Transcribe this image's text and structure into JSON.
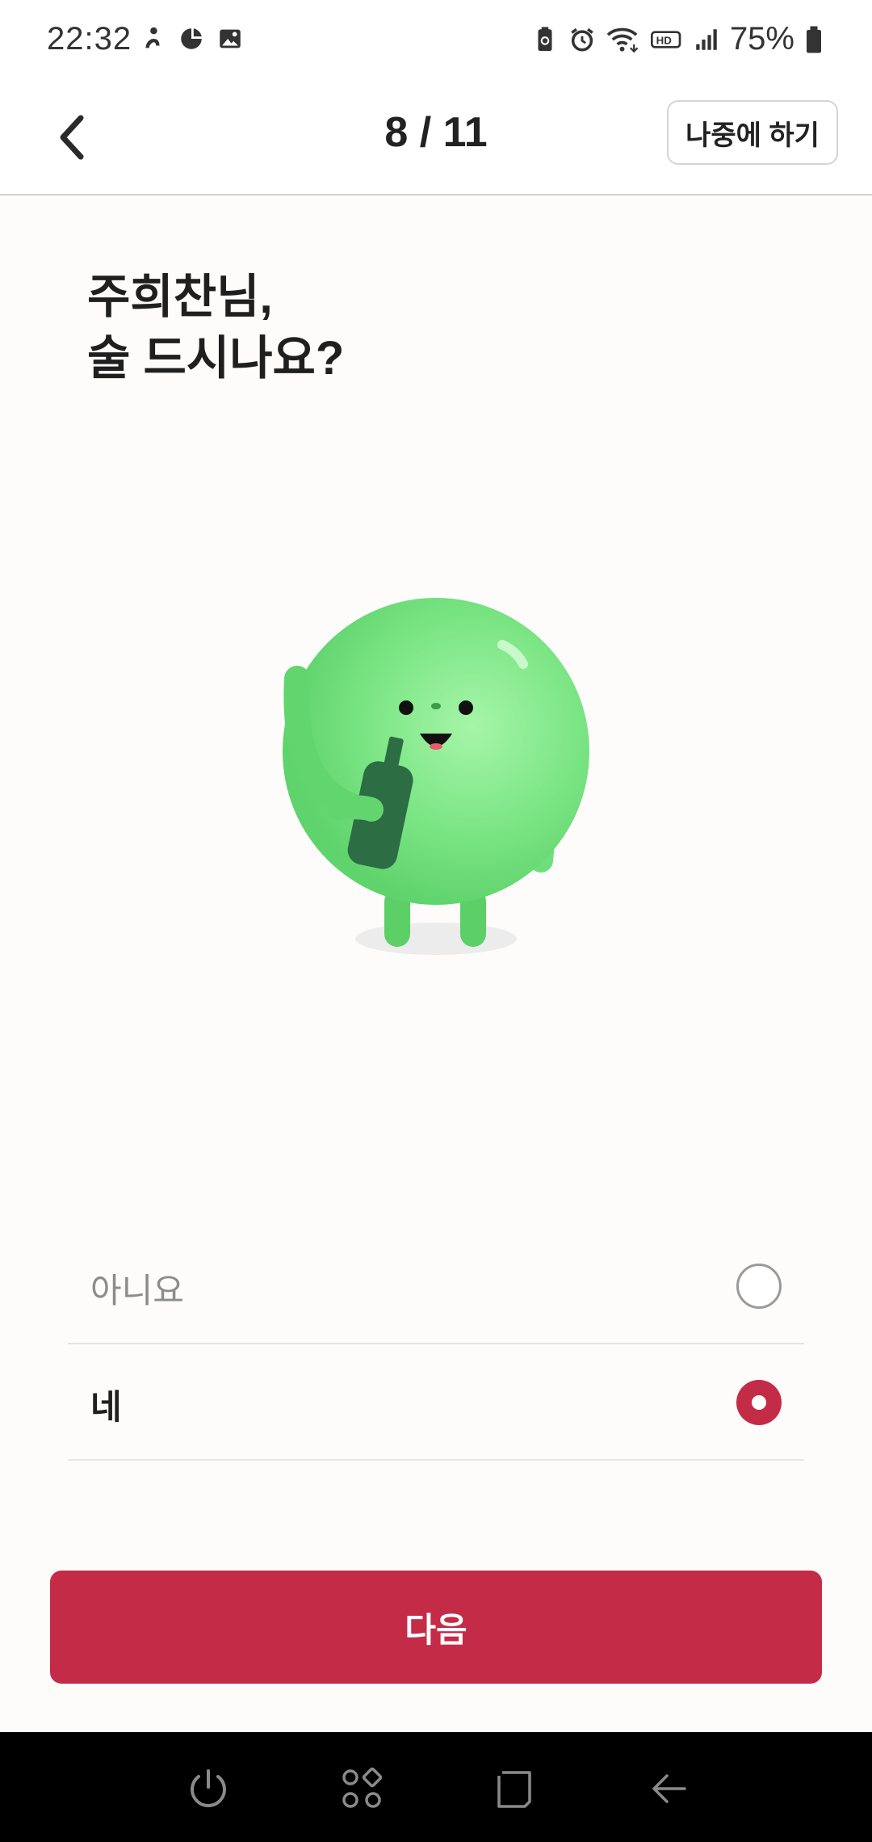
{
  "status_bar": {
    "time": "22:32",
    "battery": "75%",
    "left_icons": [
      "person-icon",
      "data-saver-icon",
      "gallery-icon"
    ],
    "right_icons": [
      "battery-saver-icon",
      "alarm-icon",
      "wifi-icon",
      "hd-voice-icon",
      "signal-icon",
      "battery-icon"
    ]
  },
  "header": {
    "progress": "8 / 11",
    "later_label": "나중에 하기"
  },
  "question": {
    "line1": "주희찬님,",
    "line2": "술 드시나요?"
  },
  "options": [
    {
      "label": "아니요",
      "selected": false
    },
    {
      "label": "네",
      "selected": true
    }
  ],
  "next_label": "다음",
  "colors": {
    "accent": "#c42b47",
    "character_green": "#6fe07f",
    "bottle_green": "#2e6e45"
  },
  "nav_bar": [
    "power-icon",
    "apps-icon",
    "recents-icon",
    "back-icon"
  ]
}
